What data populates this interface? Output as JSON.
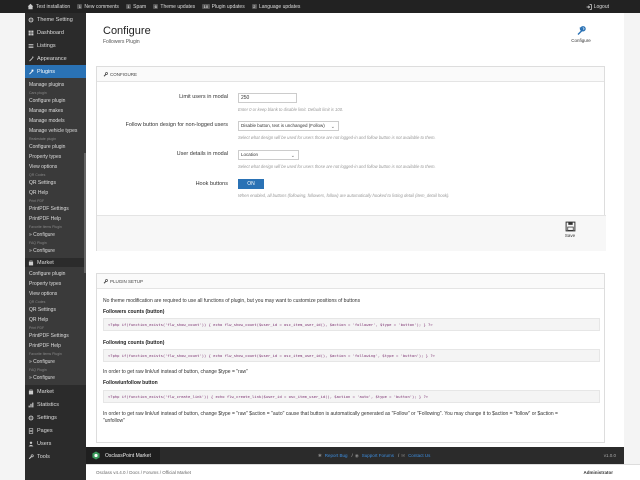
{
  "topbar": {
    "site": "Test installation",
    "items": [
      {
        "count": "1",
        "label": "New comments"
      },
      {
        "count": "1",
        "label": "Spam"
      },
      {
        "count": "6",
        "label": "Theme updates"
      },
      {
        "count": "10",
        "label": "Plugin updates"
      },
      {
        "count": "2",
        "label": "Language updates"
      }
    ],
    "logout": "Logout"
  },
  "sidebar": {
    "top_items": [
      {
        "label": "Theme Setting",
        "icon": "gear-icon"
      },
      {
        "label": "Dashboard",
        "icon": "dashboard-icon"
      },
      {
        "label": "Listings",
        "icon": "listings-icon"
      },
      {
        "label": "Appearance",
        "icon": "appearance-icon"
      },
      {
        "label": "Plugins",
        "icon": "plugin-icon"
      }
    ],
    "submenu": [
      {
        "type": "item",
        "label": "Manage plugins"
      },
      {
        "type": "cat",
        "label": "Cars plugin"
      },
      {
        "type": "item",
        "label": "Configure plugin"
      },
      {
        "type": "item",
        "label": "Manage makes"
      },
      {
        "type": "item",
        "label": "Manage models"
      },
      {
        "type": "item",
        "label": "Manage vehicle types"
      },
      {
        "type": "cat",
        "label": "Realestate plugin"
      },
      {
        "type": "item",
        "label": "Configure plugin"
      },
      {
        "type": "item",
        "label": "Property types"
      },
      {
        "type": "item",
        "label": "View options"
      },
      {
        "type": "cat",
        "label": "QR Codes"
      },
      {
        "type": "item",
        "label": "QR Settings"
      },
      {
        "type": "item",
        "label": "QR Help"
      },
      {
        "type": "cat",
        "label": "Print PDF"
      },
      {
        "type": "item",
        "label": "PrintPDF Settings"
      },
      {
        "type": "item",
        "label": "PrintPDF Help"
      },
      {
        "type": "cat",
        "label": "Favorite Items Plugin"
      },
      {
        "type": "item",
        "label": "» Configure"
      },
      {
        "type": "cat",
        "label": "FAQ Plugin"
      },
      {
        "type": "item",
        "label": "» Configure"
      }
    ],
    "market_label": "Market",
    "submenu2": [
      {
        "type": "item",
        "label": "Configure plugin"
      },
      {
        "type": "item",
        "label": "Property types"
      },
      {
        "type": "item",
        "label": "View options"
      },
      {
        "type": "cat",
        "label": "QR Codes"
      },
      {
        "type": "item",
        "label": "QR Settings"
      },
      {
        "type": "item",
        "label": "QR Help"
      },
      {
        "type": "cat",
        "label": "Print PDF"
      },
      {
        "type": "item",
        "label": "PrintPDF Settings"
      },
      {
        "type": "item",
        "label": "PrintPDF Help"
      },
      {
        "type": "cat",
        "label": "Favorite Items Plugin"
      },
      {
        "type": "item",
        "label": "» Configure"
      },
      {
        "type": "cat",
        "label": "FAQ Plugin"
      },
      {
        "type": "item",
        "label": "» Configure"
      }
    ],
    "bottom_items": [
      {
        "label": "Market",
        "icon": "market-icon"
      },
      {
        "label": "Statistics",
        "icon": "statistics-icon"
      },
      {
        "label": "Settings",
        "icon": "settings-icon"
      },
      {
        "label": "Pages",
        "icon": "pages-icon"
      },
      {
        "label": "Users",
        "icon": "users-icon"
      },
      {
        "label": "Tools",
        "icon": "tools-icon"
      }
    ]
  },
  "header": {
    "title": "Configure",
    "subtitle": "Followers Plugin",
    "configure_btn": "Configure"
  },
  "configure": {
    "heading": "Configure",
    "limit_label": "Limit users in modal",
    "limit_value": "250",
    "limit_help": "Enter 0 or keep blank to disable limit. Default limit is 100.",
    "design_label": "Follow button design for non-logged users",
    "design_value": "Disable button, text is unchanged (Follow)",
    "design_help": "Select what design will be used for users those are not logged-in and follow button is not available to them.",
    "details_label": "User details in modal",
    "details_value": "Location",
    "details_help": "Select what design will be used for users those are not logged-in and follow button is not available to them.",
    "hook_label": "Hook buttons",
    "hook_value": "ON",
    "hook_help": "When enabled, all buttons (following, followers, follow) are automatically hooked to listing detail (item_detail hook).",
    "save_label": "Save"
  },
  "setup": {
    "heading": "Plugin setup",
    "intro": "No theme modification are required to use all functions of plugin, but you may want to customize positions of buttons",
    "followers_title": "Followers counts (button)",
    "followers_code": "<?php if(function_exists('flw_show_count')) { echo flw_show_count($user_id = osc_item_user_id(), $action = 'follower', $type = 'button'); } ?>",
    "following_title": "Following counts (button)",
    "following_code": "<?php if(function_exists('flw_show_count')) { echo flw_show_count($user_id = osc_item_user_id(), $action = 'following', $type = 'button'); } ?>",
    "raw_note": "In order to get raw link/url instead of button, change $type = \"raw\"",
    "follow_title": "Follow/unfollow button",
    "follow_code": "<?php if(function_exists('flw_create_link')) { echo flw_create_link($user_id = osc_item_user_id(), $action = 'auto', $type = 'button'); } ?>",
    "final_note_1": "In order to get raw link/url instead of button, change $type = \"raw\" $action = \"auto\" cause that button is automatically generated as \"Follow\" or \"Following\". You may change it to $action = \"follow\" or $action =",
    "final_note_2": "\"unfollow\""
  },
  "footer": {
    "brand": "OsclassPoint Market",
    "report": "Report Bug",
    "support": "Support Forums",
    "contact": "Contact Us",
    "version": "v1.0.0"
  },
  "bottom": {
    "crumbs": "Osclass v4.4.0  /  Docs  /  Forums  /  Official Market",
    "admin": "Administrator"
  },
  "colors": {
    "accent": "#2a72b5",
    "sidebar": "#2b2b2b",
    "topbar": "#222222"
  }
}
